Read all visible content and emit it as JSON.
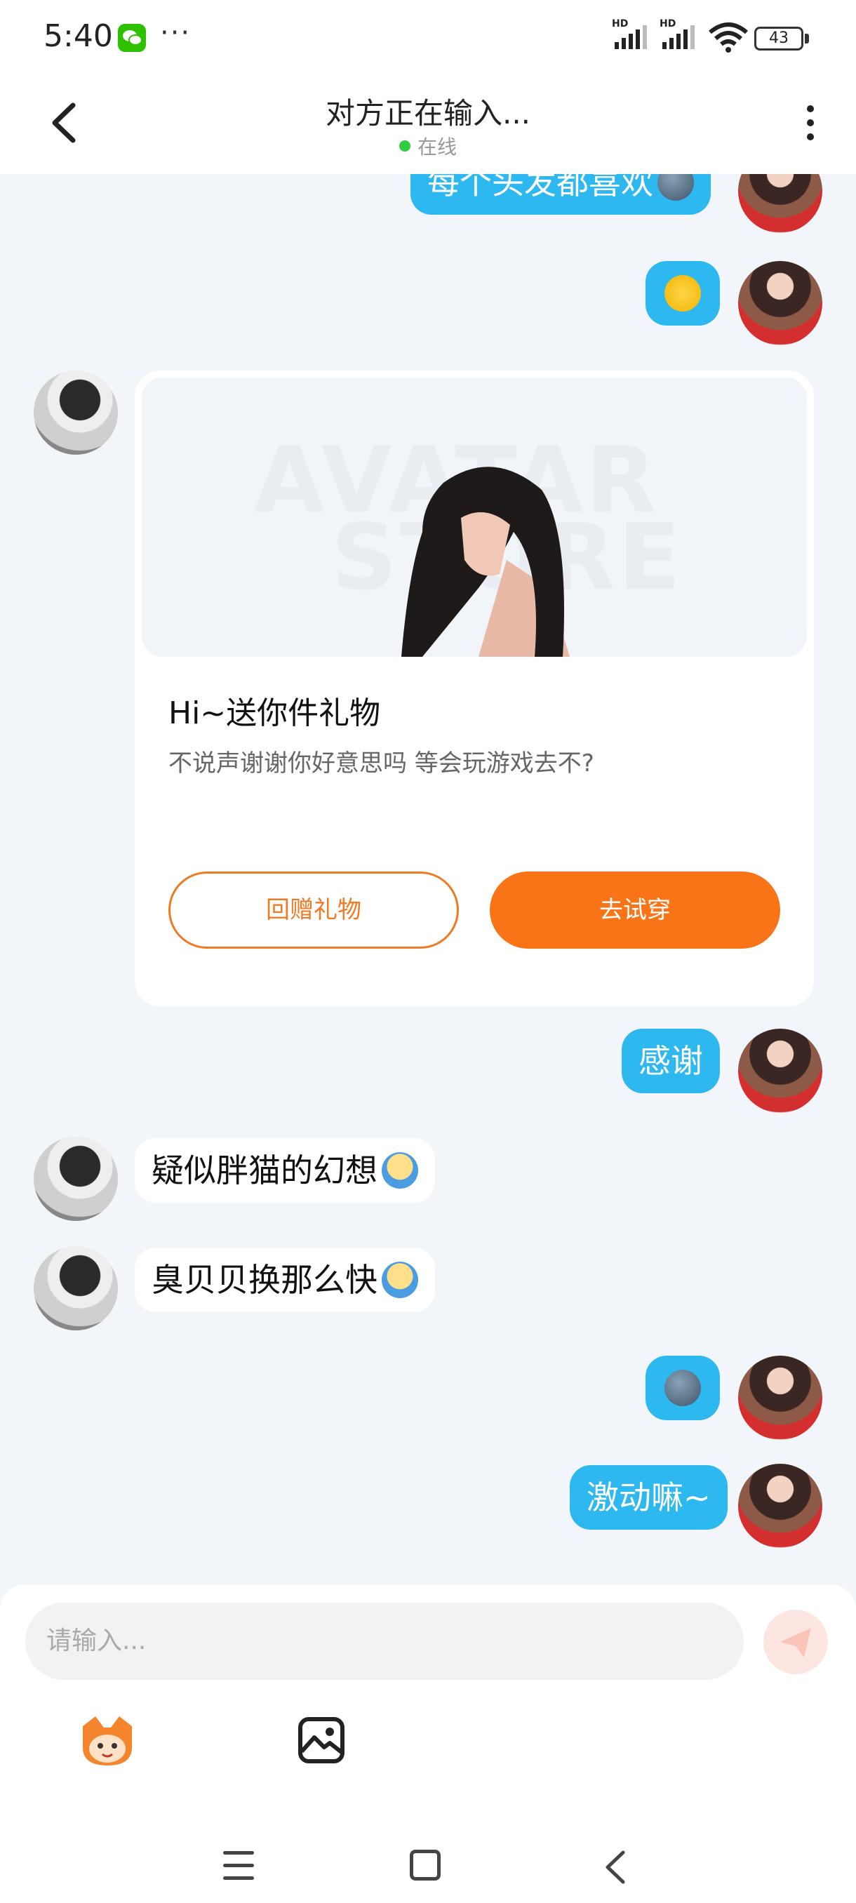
{
  "status_bar": {
    "time": "5:40",
    "more": "···",
    "hd_1": "HD",
    "hd_2": "HD",
    "battery": "43",
    "wifi_sub": "6"
  },
  "header": {
    "title": "对方正在输入...",
    "status": "在线"
  },
  "messages": [
    {
      "from": "me",
      "text": "每个头发都喜欢",
      "emoji": "moon-emoji"
    },
    {
      "from": "me",
      "text": "",
      "emoji": "heart-eyes-emoji"
    },
    {
      "from": "them",
      "type": "gift_card"
    },
    {
      "from": "me",
      "text": "感谢"
    },
    {
      "from": "them",
      "text": "疑似胖猫的幻想",
      "emoji": "scream-emoji"
    },
    {
      "from": "them",
      "text": "臭贝贝换那么快",
      "emoji": "scream-emoji"
    },
    {
      "from": "me",
      "text": "",
      "emoji": "moon-emoji"
    },
    {
      "from": "me",
      "text": "激动嘛~"
    }
  ],
  "gift_card": {
    "watermark_1": "AVATAR",
    "watermark_2": "STORE",
    "title": "Hi~送你件礼物",
    "subtitle": "不说声谢谢你好意思吗 等会玩游戏去不?",
    "return_gift_label": "回赠礼物",
    "try_on_label": "去试穿"
  },
  "input": {
    "placeholder": "请输入..."
  },
  "colors": {
    "my_bubble": "#2db8f0",
    "accent_orange": "#f97317",
    "online_dot": "#2ecc40",
    "background": "#f2f5f9"
  }
}
